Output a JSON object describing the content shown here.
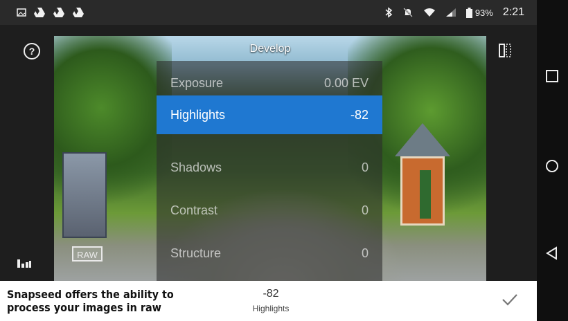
{
  "statusbar": {
    "left_icons": [
      "image-icon",
      "drive-icon",
      "drive-icon",
      "drive-icon"
    ],
    "right_icons": [
      "bluetooth-icon",
      "mute-icon",
      "wifi-icon",
      "signal-icon",
      "battery-icon"
    ],
    "battery_percent": "93%",
    "time": "2:21"
  },
  "app": {
    "title": "Develop",
    "help_label": "?",
    "raw_badge": "RAW"
  },
  "menu": {
    "items": [
      {
        "label": "Exposure",
        "value": "0.00 EV"
      },
      {
        "label": "Highlights",
        "value": "-82"
      },
      {
        "label": "Shadows",
        "value": "0"
      },
      {
        "label": "Contrast",
        "value": "0"
      },
      {
        "label": "Structure",
        "value": "0"
      }
    ],
    "selected_index": 1
  },
  "bottom": {
    "caption": "Snapseed offers the ability to process your images in raw",
    "current_value": "-82",
    "current_label": "Highlights"
  },
  "colors": {
    "accent": "#1f78d1",
    "statusbar_bg": "#2a2a2a",
    "navbar_bg": "#0f0f0f"
  }
}
